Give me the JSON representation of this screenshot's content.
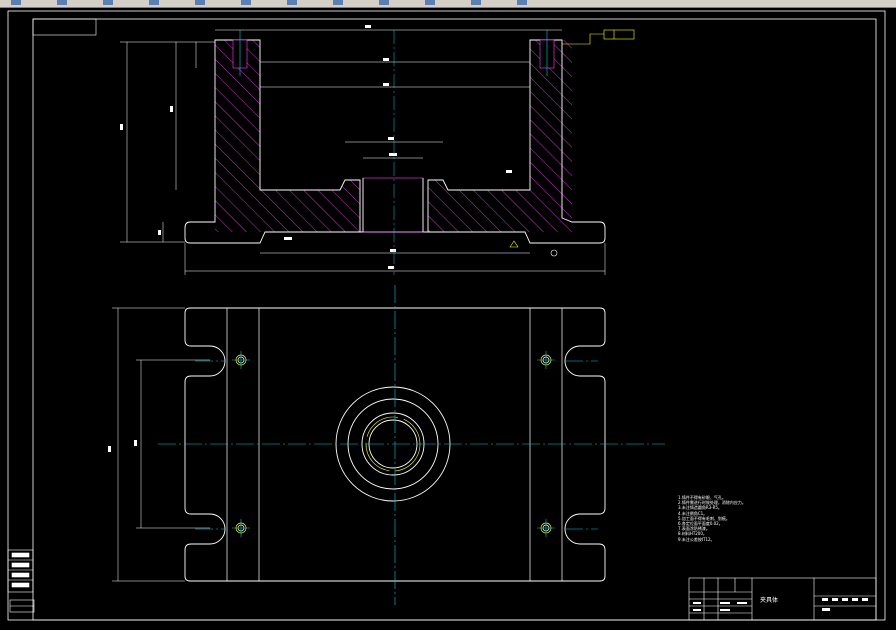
{
  "toolbar": {
    "buttons": [
      {
        "icon": "undo-icon"
      },
      {
        "icon": "redo-icon"
      },
      {
        "icon": "pan-icon"
      },
      {
        "icon": "zoom-icon"
      },
      {
        "icon": "layer-icon"
      },
      {
        "icon": "properties-icon"
      },
      {
        "icon": "match-icon"
      },
      {
        "icon": "print-icon"
      },
      {
        "icon": "block-icon"
      },
      {
        "icon": "table-icon"
      },
      {
        "icon": "calc-icon"
      },
      {
        "icon": "help-icon"
      }
    ]
  },
  "drawing": {
    "title_block_name": "夹具体",
    "colors": {
      "outline": "#ffffff",
      "centerline": "#00c8d8",
      "hatch": "#ff3cff",
      "accent": "#ffff00",
      "background": "#000000"
    },
    "notes": [
      "1.铸件不得有砂眼、气孔。",
      "2.铸件需进行时效处理，消除内应力。",
      "3.未注铸造圆角R3-R5。",
      "4.未注倒角C1。",
      "5.加工面不得有毛刺、划痕。",
      "6.各定位面平面度0.02。",
      "7.表面涂防锈漆。",
      "8.材料HT200。",
      "9.未注公差按IT12。"
    ]
  }
}
